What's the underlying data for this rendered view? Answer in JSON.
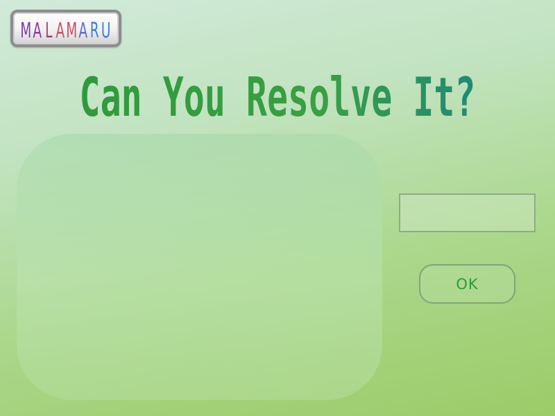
{
  "logo": {
    "text": "MALAMARU",
    "colors": [
      "#7c3fa3",
      "#8a3c9e",
      "#a23c7d",
      "#c8506a",
      "#c9506a",
      "#5a6fc4",
      "#3f7ed0",
      "#3f7ed0"
    ]
  },
  "title": {
    "text": "Can You Resolve It?",
    "color_start": "#2f9a3c",
    "color_end": "#1f8a78"
  },
  "answer_input": {
    "value": "",
    "placeholder": ""
  },
  "ok_button": {
    "label": "OK"
  }
}
